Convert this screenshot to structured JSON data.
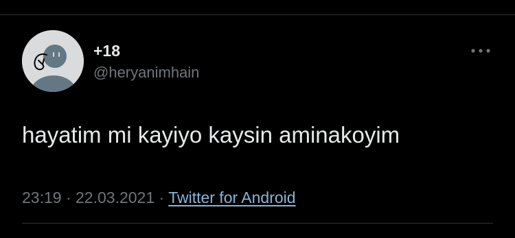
{
  "tweet": {
    "display_name": "+18",
    "handle": "@heryanimhain",
    "text": "hayatim mi kayiyo kaysin aminakoyim",
    "time": "23:19",
    "separator": "·",
    "date": "22.03.2021",
    "source": "Twitter for Android"
  },
  "icons": {
    "avatar": "anonymous-avatar-icon",
    "more": "more-horizontal-icon"
  },
  "colors": {
    "background": "#000000",
    "text": "#e7e9ea",
    "secondary": "#71767b",
    "link": "#8ab4d8",
    "divider": "#2f3336"
  }
}
